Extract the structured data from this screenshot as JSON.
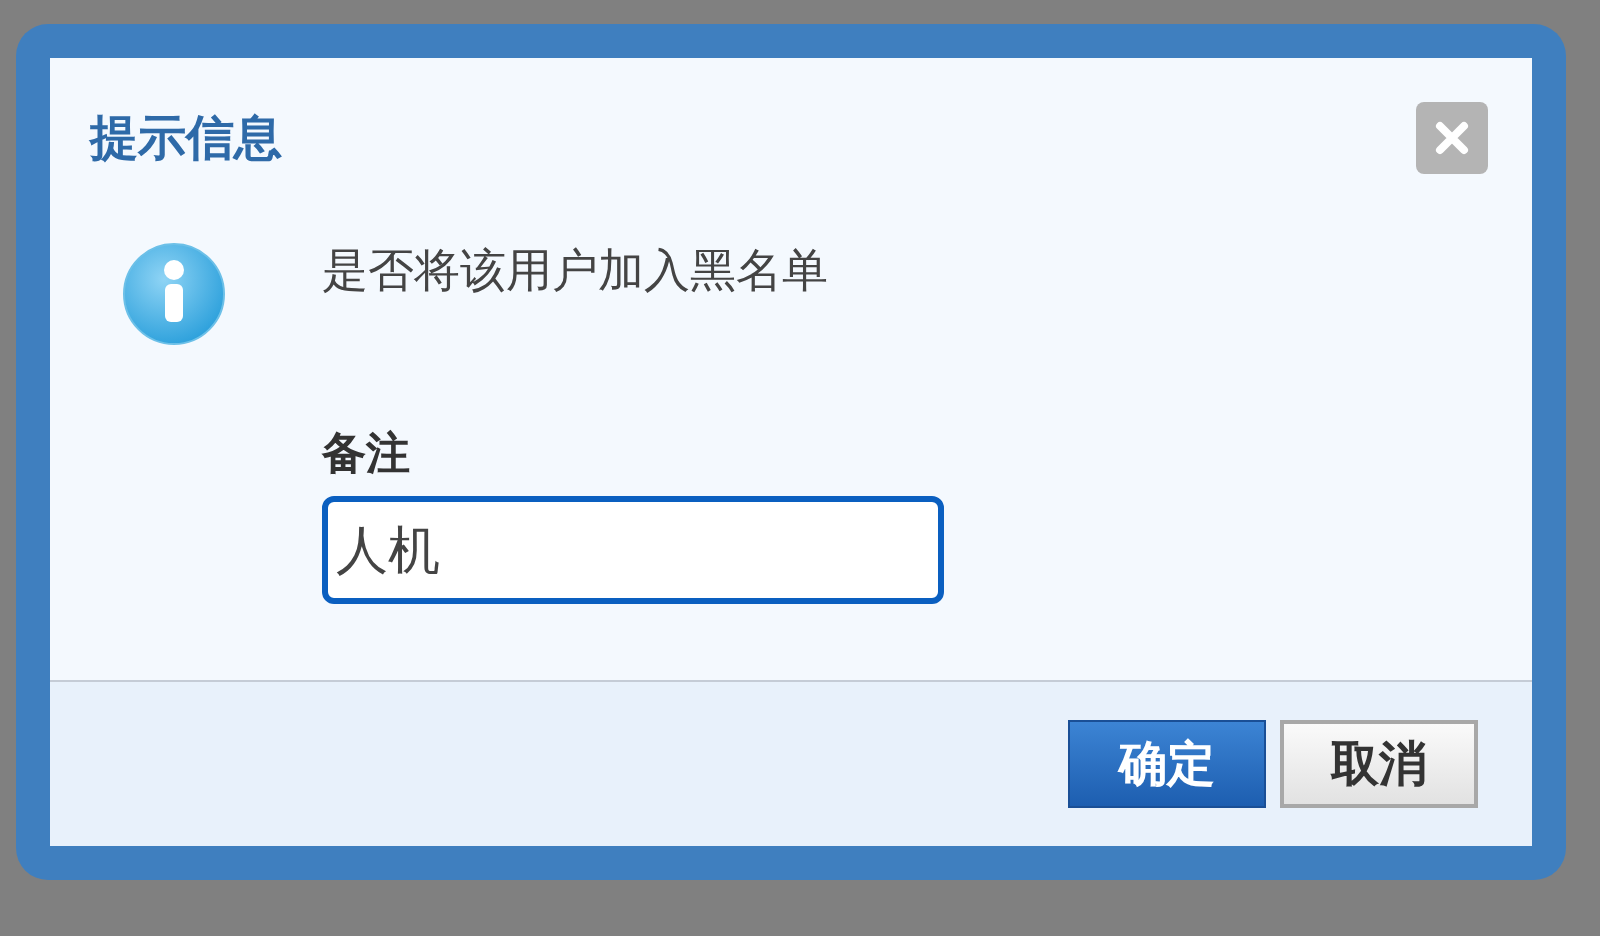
{
  "dialog": {
    "title": "提示信息",
    "message": "是否将该用户加入黑名单",
    "field": {
      "label": "备注",
      "value": "人机"
    },
    "buttons": [
      {
        "label": "确定",
        "kind": "primary"
      },
      {
        "label": "取消",
        "kind": "default"
      }
    ]
  }
}
